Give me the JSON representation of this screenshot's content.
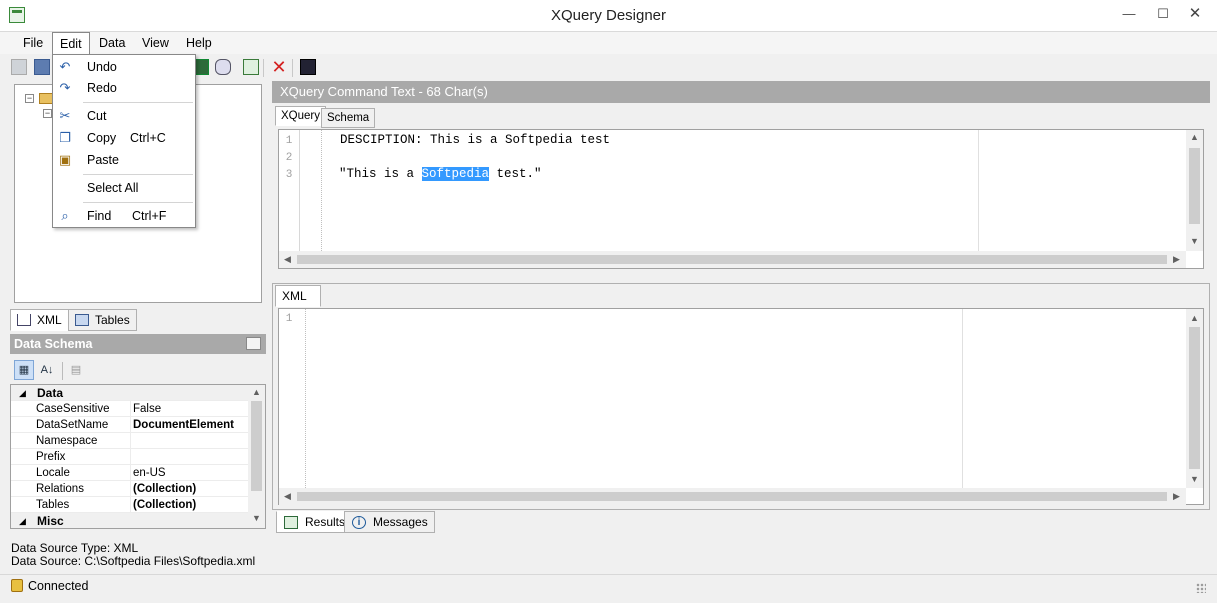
{
  "window": {
    "title": "XQuery Designer",
    "controls": {
      "minimize": "—",
      "maximize": "☐",
      "close": "✕"
    }
  },
  "menu": {
    "file": "File",
    "edit": "Edit",
    "data": "Data",
    "view": "View",
    "help": "Help"
  },
  "edit_menu": {
    "undo": "Undo",
    "redo": "Redo",
    "cut": "Cut",
    "copy": "Copy",
    "copy_shortcut": "Ctrl+C",
    "paste": "Paste",
    "select_all": "Select All",
    "find": "Find",
    "find_shortcut": "Ctrl+F"
  },
  "left_tabs": {
    "xml": "XML",
    "tables": "Tables"
  },
  "schema": {
    "header": "Data Schema",
    "categories": [
      {
        "name": "Data",
        "properties": [
          {
            "name": "CaseSensitive",
            "value": "False",
            "bold": false
          },
          {
            "name": "DataSetName",
            "value": "DocumentElement",
            "bold": true
          },
          {
            "name": "Namespace",
            "value": "",
            "bold": false
          },
          {
            "name": "Prefix",
            "value": "",
            "bold": false
          },
          {
            "name": "Locale",
            "value": "en-US",
            "bold": false
          },
          {
            "name": "Relations",
            "value": "(Collection)",
            "bold": true
          },
          {
            "name": "Tables",
            "value": "(Collection)",
            "bold": true
          }
        ]
      },
      {
        "name": "Misc",
        "properties": []
      }
    ]
  },
  "query": {
    "header": "XQuery Command Text - 68 Char(s)",
    "tabs": {
      "xquery": "XQuery",
      "schema": "Schema"
    },
    "line_numbers": [
      "1",
      "2",
      "3"
    ],
    "line1": "  DESCIPTION: This is a Softpedia test",
    "line3_before": "\"This is a ",
    "line3_selected": "Softpedia",
    "line3_after": " test.\""
  },
  "xml_pane": {
    "tab": "XML",
    "line_numbers": [
      "1"
    ]
  },
  "bottom_tabs": {
    "results": "Results",
    "messages": "Messages"
  },
  "status": {
    "source_type": "Data Source Type: XML",
    "source": "Data Source: C:\\Softpedia Files\\Softpedia.xml",
    "connection": "Connected"
  },
  "colors": {
    "panel_header": "#a9a9a9",
    "selection": "#3399ff",
    "delete_icon": "#d42020"
  }
}
